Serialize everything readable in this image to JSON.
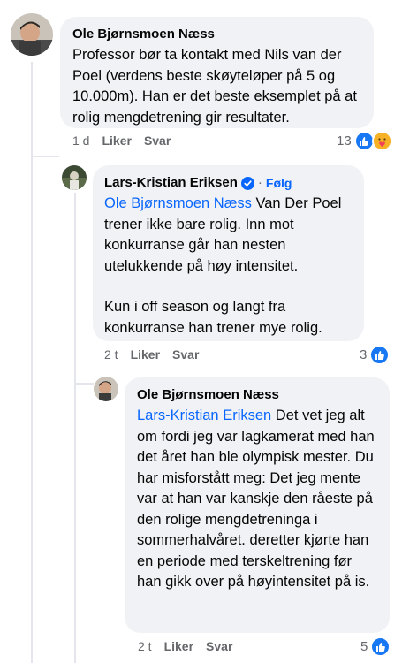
{
  "comments": [
    {
      "author": "Ole Bjørnsmoen Næss",
      "text": "Professor bør ta kontakt med Nils van der Poel (verdens beste skøyteløper på 5 og 10.000m). Han er det beste eksemplet på at rolig mengdetrening gir resultater.",
      "time": "1 d",
      "like_label": "Liker",
      "reply_label": "Svar",
      "reaction_count": "13"
    },
    {
      "author": "Lars-Kristian Eriksen",
      "follow_label": "Følg",
      "mention": "Ole Bjørnsmoen Næss",
      "text_after_mention": " Van Der Poel trener ikke bare rolig.  Inn mot konkurranse går han nesten utelukkende på høy intensitet.",
      "text_paragraph2": "Kun i off season og langt fra konkurranse han trener mye rolig.",
      "time": "2 t",
      "like_label": "Liker",
      "reply_label": "Svar",
      "reaction_count": "3"
    },
    {
      "author": "Ole Bjørnsmoen Næss",
      "mention": "Lars-Kristian Eriksen",
      "text_after_mention": " Det vet jeg alt om fordi jeg var lagkamerat med han det året han ble olympisk mester. Du har misforstått meg: Det jeg mente var at han var kanskje den råeste på den rolige mengdetreninga i sommerhalvåret. deretter kjørte han en periode med terskeltrening før han gikk over på høyintensitet på is.",
      "time": "2 t",
      "like_label": "Liker",
      "reply_label": "Svar",
      "reaction_count": "5"
    }
  ],
  "icons": {
    "like_reaction": "like-thumb-icon",
    "care_reaction": "care-hug-icon",
    "verified": "verified-badge-icon"
  },
  "colors": {
    "bubble": "#f0f2f5",
    "mention": "#0866ff",
    "like_blue": "#1877f2",
    "meta_gray": "#65676b"
  }
}
